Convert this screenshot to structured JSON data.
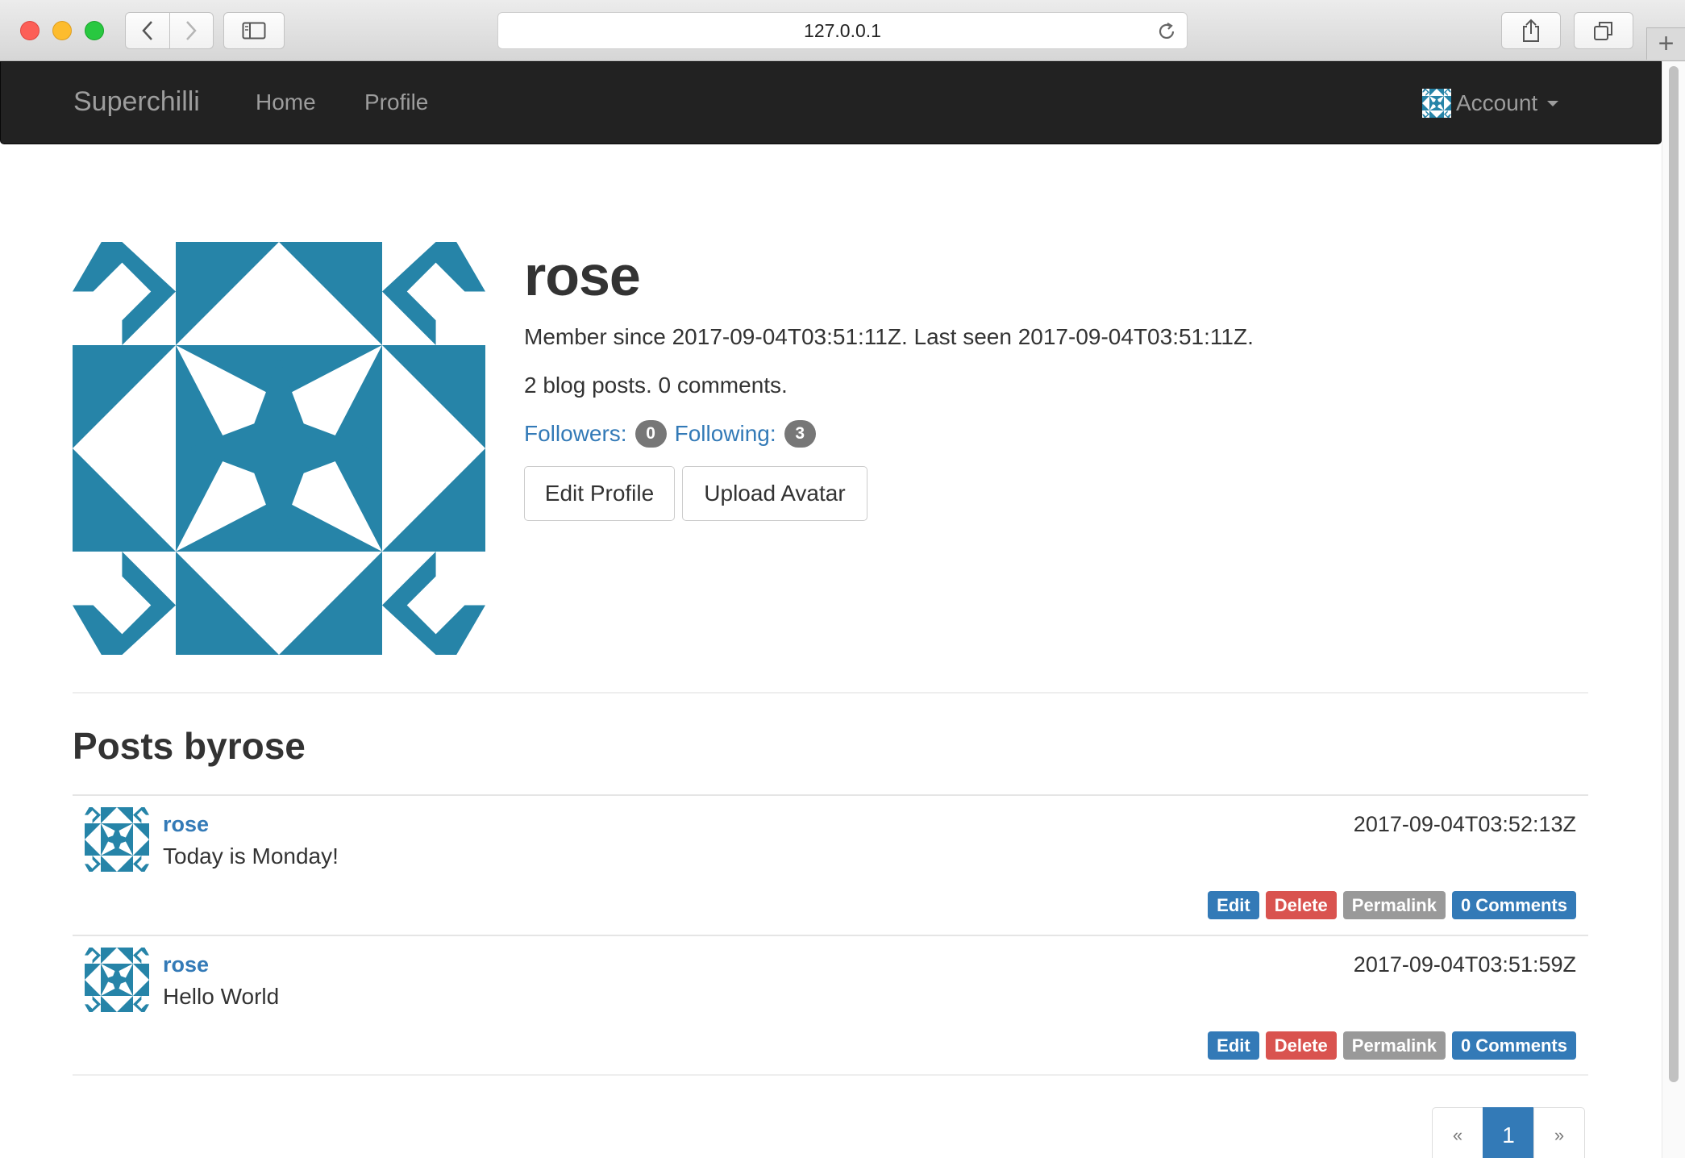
{
  "browser": {
    "url": "127.0.0.1",
    "new_tab_label": "+"
  },
  "navbar": {
    "brand": "Superchilli",
    "links": [
      "Home",
      "Profile"
    ],
    "account_label": "Account"
  },
  "profile": {
    "username": "rose",
    "member_line": "Member since 2017-09-04T03:51:11Z. Last seen 2017-09-04T03:51:11Z.",
    "counts_line": "2 blog posts. 0 comments.",
    "followers_label": "Followers:",
    "followers_count": "0",
    "following_label": "Following:",
    "following_count": "3",
    "edit_profile_label": "Edit Profile",
    "upload_avatar_label": "Upload Avatar"
  },
  "posts": {
    "heading": "Posts byrose",
    "items": [
      {
        "author": "rose",
        "body": "Today is Monday!",
        "timestamp": "2017-09-04T03:52:13Z",
        "edit_label": "Edit",
        "delete_label": "Delete",
        "permalink_label": "Permalink",
        "comments_label": "0 Comments"
      },
      {
        "author": "rose",
        "body": "Hello World",
        "timestamp": "2017-09-04T03:51:59Z",
        "edit_label": "Edit",
        "delete_label": "Delete",
        "permalink_label": "Permalink",
        "comments_label": "0 Comments"
      }
    ]
  },
  "pagination": {
    "prev": "«",
    "current": "1",
    "next": "»"
  },
  "colors": {
    "identicon": "#2684a8",
    "link": "#337ab7",
    "danger": "#d9534f",
    "navbar_bg": "#222222"
  }
}
